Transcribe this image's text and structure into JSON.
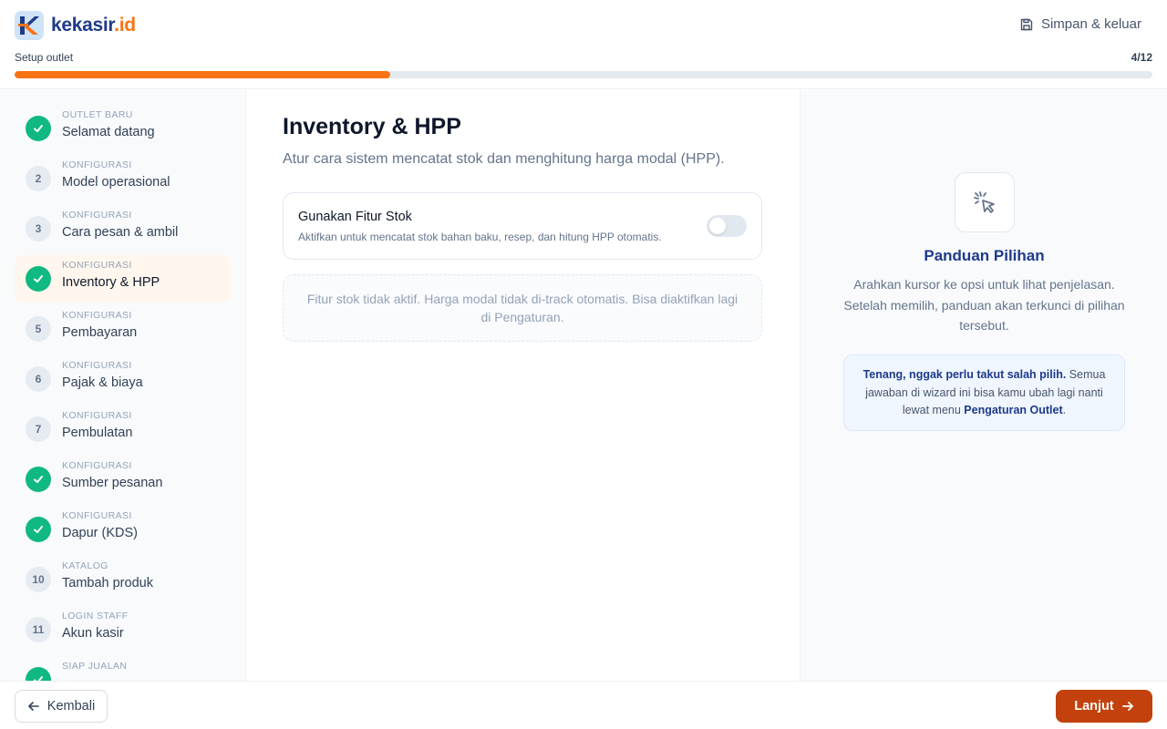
{
  "brand": {
    "name": "kekasir",
    "tld": ".id",
    "accent": "#f97316",
    "primary": "#1e3a8a"
  },
  "header": {
    "save_exit_label": "Simpan & keluar",
    "setup_label": "Setup outlet",
    "step_count": "4/12",
    "progress_fraction": 0.33
  },
  "sidebar": {
    "steps": [
      {
        "num": "1",
        "category": "OUTLET BARU",
        "title": "Selamat datang",
        "status": "done"
      },
      {
        "num": "2",
        "category": "KONFIGURASI",
        "title": "Model operasional",
        "status": "todo"
      },
      {
        "num": "3",
        "category": "KONFIGURASI",
        "title": "Cara pesan & ambil",
        "status": "todo"
      },
      {
        "num": "4",
        "category": "KONFIGURASI",
        "title": "Inventory & HPP",
        "status": "done",
        "active": true
      },
      {
        "num": "5",
        "category": "KONFIGURASI",
        "title": "Pembayaran",
        "status": "todo"
      },
      {
        "num": "6",
        "category": "KONFIGURASI",
        "title": "Pajak & biaya",
        "status": "todo"
      },
      {
        "num": "7",
        "category": "KONFIGURASI",
        "title": "Pembulatan",
        "status": "todo"
      },
      {
        "num": "8",
        "category": "KONFIGURASI",
        "title": "Sumber pesanan",
        "status": "done"
      },
      {
        "num": "9",
        "category": "KONFIGURASI",
        "title": "Dapur (KDS)",
        "status": "done"
      },
      {
        "num": "10",
        "category": "KATALOG",
        "title": "Tambah produk",
        "status": "todo"
      },
      {
        "num": "11",
        "category": "LOGIN STAFF",
        "title": "Akun kasir",
        "status": "todo"
      },
      {
        "num": "12",
        "category": "SIAP JUALAN",
        "title": "",
        "status": "done"
      }
    ]
  },
  "main": {
    "title": "Inventory & HPP",
    "subtitle": "Atur cara sistem mencatat stok dan menghitung harga modal (HPP).",
    "stock_card": {
      "title": "Gunakan Fitur Stok",
      "description": "Aktifkan untuk mencatat stok bahan baku, resep, dan hitung HPP otomatis.",
      "enabled": false
    },
    "notice": "Fitur stok tidak aktif. Harga modal tidak di-track otomatis. Bisa diaktifkan lagi di Pengaturan."
  },
  "guide": {
    "icon": "cursor-click-icon",
    "title": "Panduan Pilihan",
    "description": "Arahkan kursor ke opsi untuk lihat penjelasan. Setelah memilih, panduan akan terkunci di pilihan tersebut.",
    "tip_bold": "Tenang, nggak perlu takut salah pilih.",
    "tip_text": " Semua jawaban di wizard ini bisa kamu ubah lagi nanti lewat menu ",
    "tip_link": "Pengaturan Outlet",
    "tip_end": "."
  },
  "footer": {
    "back_label": "Kembali",
    "next_label": "Lanjut"
  }
}
